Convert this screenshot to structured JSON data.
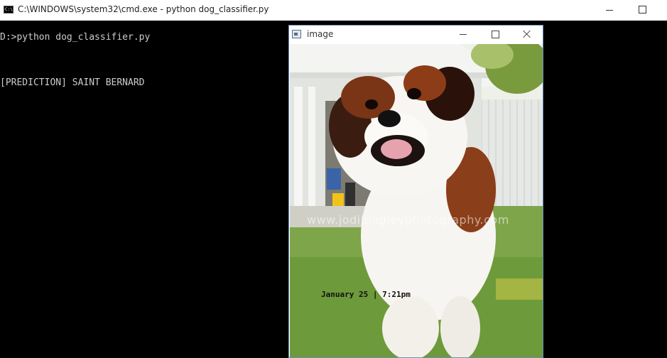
{
  "cmd_window": {
    "title": "C:\\WINDOWS\\system32\\cmd.exe - python  dog_classifier.py",
    "icon": "C:\\"
  },
  "console": {
    "lines": [
      "D:>python dog_classifier.py",
      "[PREDICTION] SAINT BERNARD"
    ]
  },
  "image_window": {
    "title": "image",
    "photo": {
      "watermark": "www.jodibingleyphotography.com",
      "date_overlay": "January 25 | 7:21pm"
    }
  }
}
